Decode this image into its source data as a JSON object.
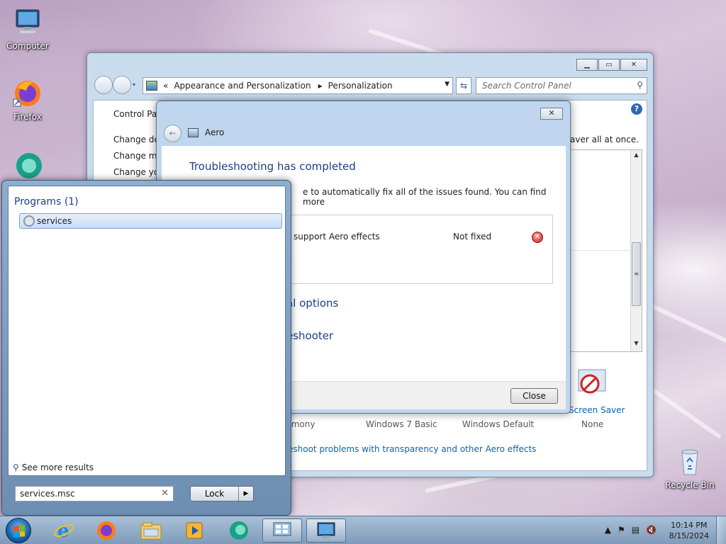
{
  "desktop": {
    "icons": [
      {
        "label": "Computer"
      },
      {
        "label": "Firefox"
      },
      {
        "label": "Recycle Bin"
      }
    ]
  },
  "control_panel": {
    "breadcrumb": {
      "prefix": "«",
      "items": [
        "Appearance and Personalization",
        "Personalization"
      ]
    },
    "search_placeholder": "Search Control Panel",
    "sidebar": {
      "title": "Control Pan",
      "items": [
        "Change des",
        "Change mo",
        "Change you"
      ]
    },
    "description_fragment": "aver all at once.",
    "screen_saver_label": "Screen Saver",
    "screen_saver_value": "None",
    "theme_labels": [
      "rmony",
      "Windows 7 Basic",
      "Windows Default"
    ],
    "troubleshoot_link": "eshoot problems with transparency and other Aero effects"
  },
  "aero_dialog": {
    "title": "Aero",
    "heading": "Troubleshooting has completed",
    "line1": "e to automatically fix all of the issues found. You can find more",
    "issue": {
      "name": "support Aero effects",
      "status": "Not fixed"
    },
    "option1": "al options",
    "option2": "eshooter",
    "close_label": "Close"
  },
  "start_menu": {
    "section_header": "Programs (1)",
    "result": "services",
    "see_more": "See more results",
    "search_value": "services.msc",
    "lock_label": "Lock"
  },
  "taskbar": {
    "time": "10:14 PM",
    "date": "8/15/2024"
  }
}
